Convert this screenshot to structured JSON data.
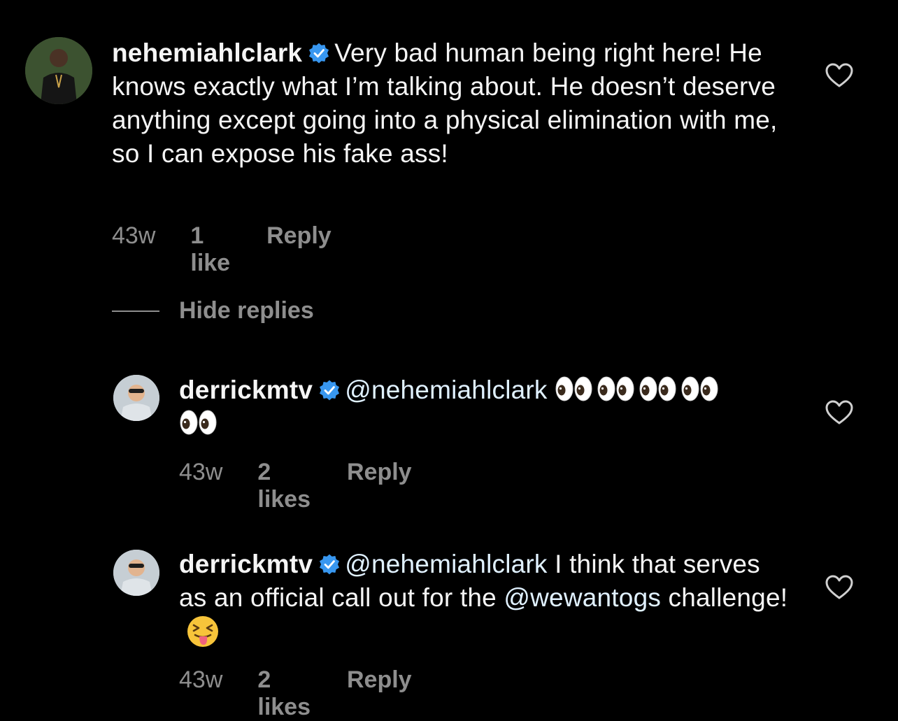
{
  "comments": [
    {
      "username": "nehemiahlclark",
      "text": "Very bad human being right here! He knows exactly what I’m talking about. He doesn’t deserve anything except going into a physical elimination with me, so I can expose his fake ass!",
      "time": "43w",
      "likes": "1 like",
      "reply_label": "Reply"
    }
  ],
  "hide_replies_label": "Hide replies",
  "replies": [
    {
      "username": "derrickmtv",
      "mention": "@nehemiahlclark",
      "eyes_count": 5,
      "time": "43w",
      "likes": "2 likes",
      "reply_label": "Reply"
    },
    {
      "username": "derrickmtv",
      "mention": "@nehemiahlclark",
      "text_a": " I think that serves as an official call out for the ",
      "mention2": "@wewantogs",
      "text_b": " challenge!",
      "emoji": "squinting-face-with-tongue",
      "time": "43w",
      "likes": "2 likes",
      "reply_label": "Reply"
    }
  ],
  "colors": {
    "background": "#000000",
    "text": "#f5f5f5",
    "meta": "#8e8e8e",
    "mention": "#e0f1ff",
    "verified": "#3897f0"
  },
  "icons": [
    "verified-badge-icon",
    "heart-outline-icon",
    "eyes-emoji",
    "squinting-tongue-emoji"
  ]
}
